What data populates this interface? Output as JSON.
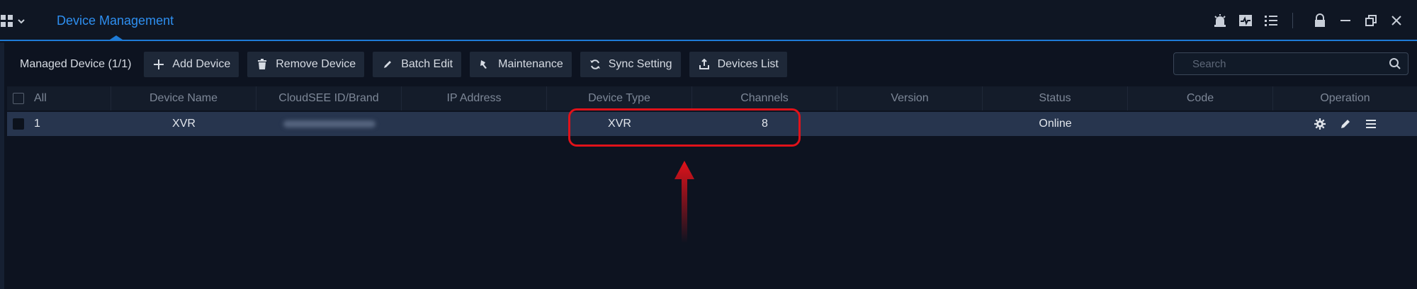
{
  "titlebar": {
    "active_tab": "Device Management",
    "icons": [
      "apps-grid-icon",
      "chevron-down-icon",
      "alarm-icon",
      "monitor-icon",
      "list-icon",
      "lock-icon",
      "minimize-icon",
      "restore-icon",
      "close-icon"
    ]
  },
  "toolbar": {
    "managed_label": "Managed Device (1/1)",
    "buttons": [
      {
        "label": "Add Device",
        "icon": "plus-icon"
      },
      {
        "label": "Remove Device",
        "icon": "trash-icon"
      },
      {
        "label": "Batch Edit",
        "icon": "pencil-icon"
      },
      {
        "label": "Maintenance",
        "icon": "wrench-icon"
      },
      {
        "label": "Sync Setting",
        "icon": "sync-icon"
      },
      {
        "label": "Devices List",
        "icon": "export-icon"
      }
    ],
    "search_placeholder": "Search"
  },
  "table": {
    "columns": [
      "All",
      "Device Name",
      "CloudSEE ID/Brand",
      "IP Address",
      "Device Type",
      "Channels",
      "Version",
      "Status",
      "Code",
      "Operation"
    ],
    "rows": [
      {
        "index": "1",
        "device_name": "XVR",
        "cloudsee_id": "",
        "ip_address": "",
        "device_type": "XVR",
        "channels": "8",
        "version": "",
        "status": "Online",
        "code": ""
      }
    ]
  },
  "colors": {
    "accent": "#2e8ff0",
    "highlight": "#e0121a",
    "row_selected": "#27354e",
    "background": "#0d1320"
  }
}
